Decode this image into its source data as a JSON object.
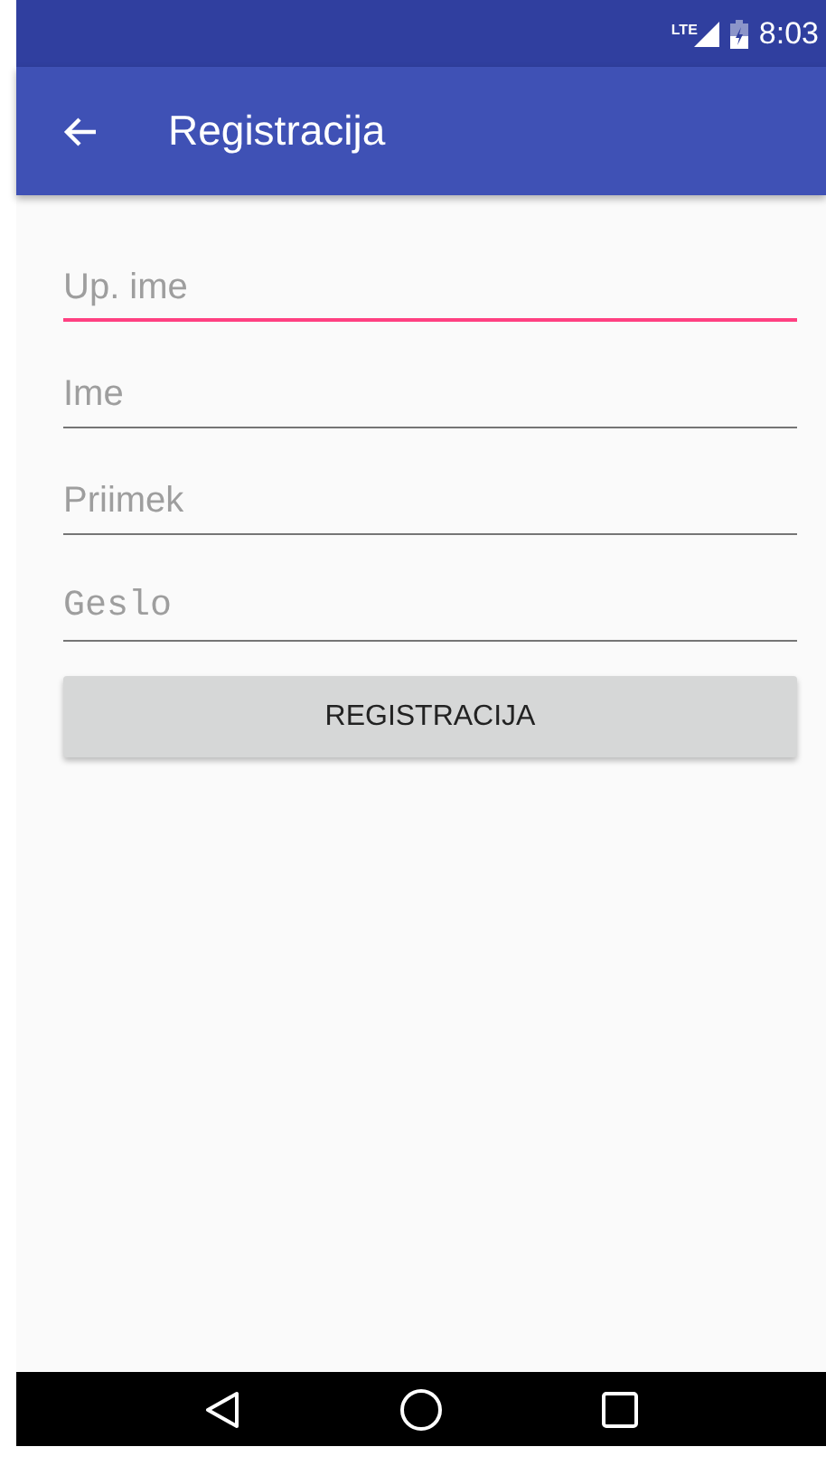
{
  "status_bar": {
    "network": "LTE",
    "time": "8:03"
  },
  "app_bar": {
    "title": "Registracija"
  },
  "fields": [
    {
      "placeholder": "Up. ime",
      "kind": "text",
      "focused": true
    },
    {
      "placeholder": "Ime",
      "kind": "text",
      "focused": false
    },
    {
      "placeholder": "Priimek",
      "kind": "text",
      "focused": false
    },
    {
      "placeholder": "Geslo",
      "kind": "password",
      "focused": false
    }
  ],
  "button": {
    "label": "REGISTRACIJA"
  }
}
